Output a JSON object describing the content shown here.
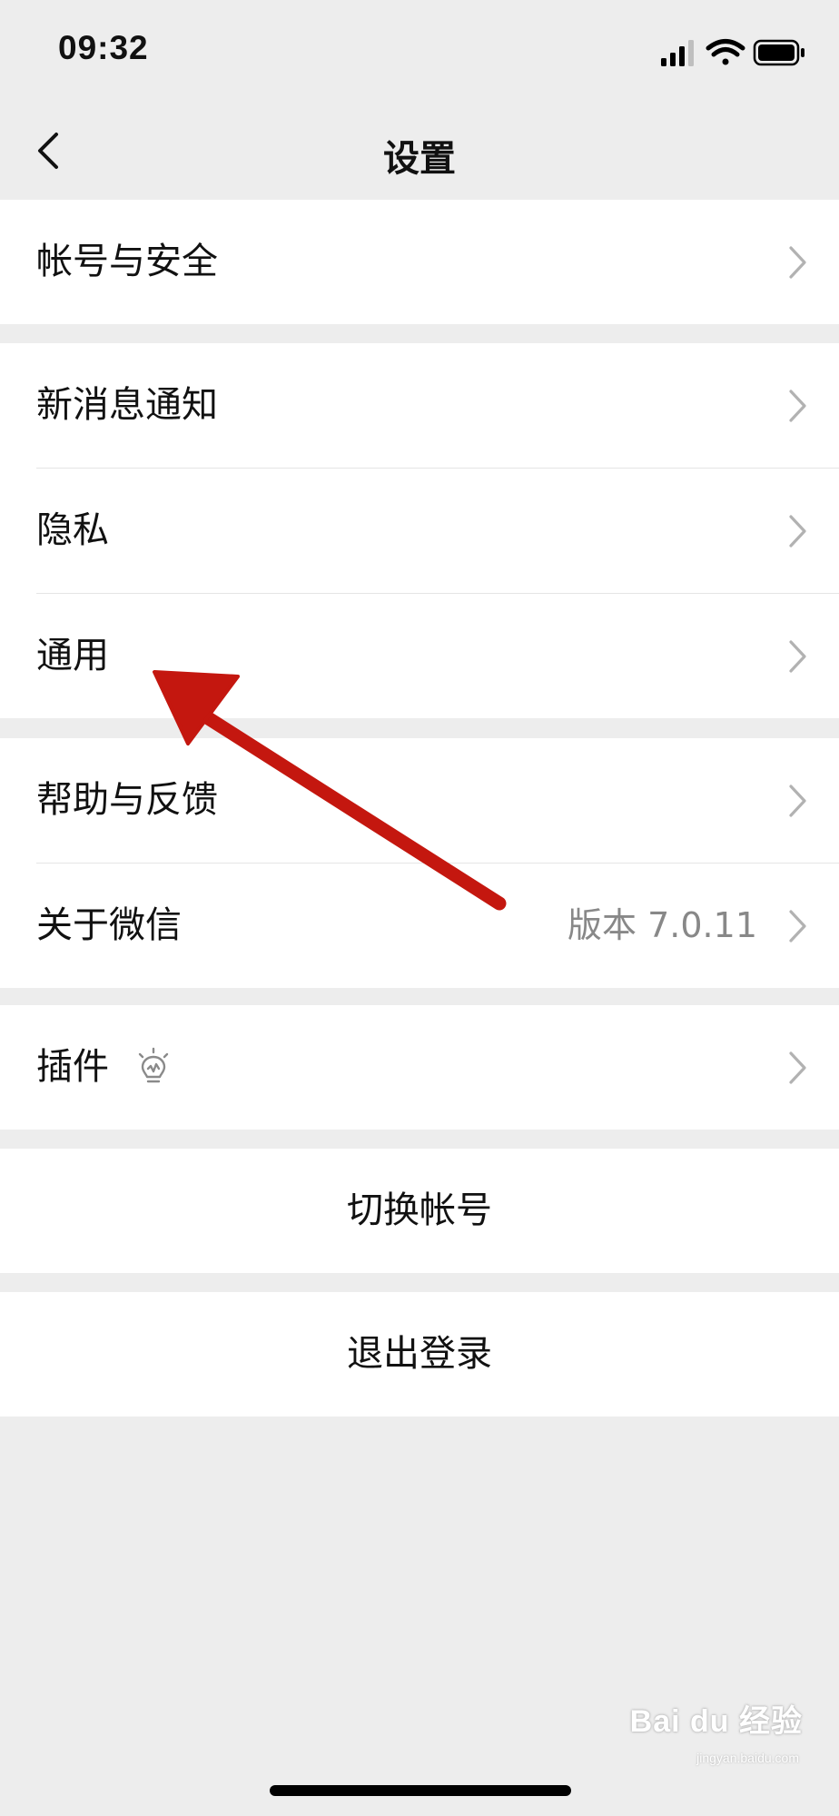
{
  "status_bar": {
    "time": "09:32",
    "icons": [
      "signal-icon",
      "wifi-icon",
      "battery-icon"
    ]
  },
  "nav": {
    "title": "设置",
    "back_icon": "back-chevron-icon"
  },
  "groups": {
    "account": {
      "items": [
        {
          "label": "帐号与安全"
        }
      ]
    },
    "main": {
      "items": [
        {
          "label": "新消息通知"
        },
        {
          "label": "隐私"
        },
        {
          "label": "通用"
        }
      ]
    },
    "help": {
      "items": [
        {
          "label": "帮助与反馈"
        },
        {
          "label": "关于微信",
          "value": "版本 7.0.11"
        }
      ]
    },
    "plugins": {
      "items": [
        {
          "label": "插件",
          "icon": "lightbulb-icon"
        }
      ]
    }
  },
  "actions": {
    "switch_account": "切换帐号",
    "logout": "退出登录"
  },
  "watermark": {
    "brand": "Bai du 经验",
    "url": "jingyan.baidu.com"
  },
  "colors": {
    "background": "#ededed",
    "cell_background": "#ffffff",
    "chevron": "#b2b2b2",
    "value_text": "#888888",
    "annotation_arrow": "#c4170f"
  }
}
